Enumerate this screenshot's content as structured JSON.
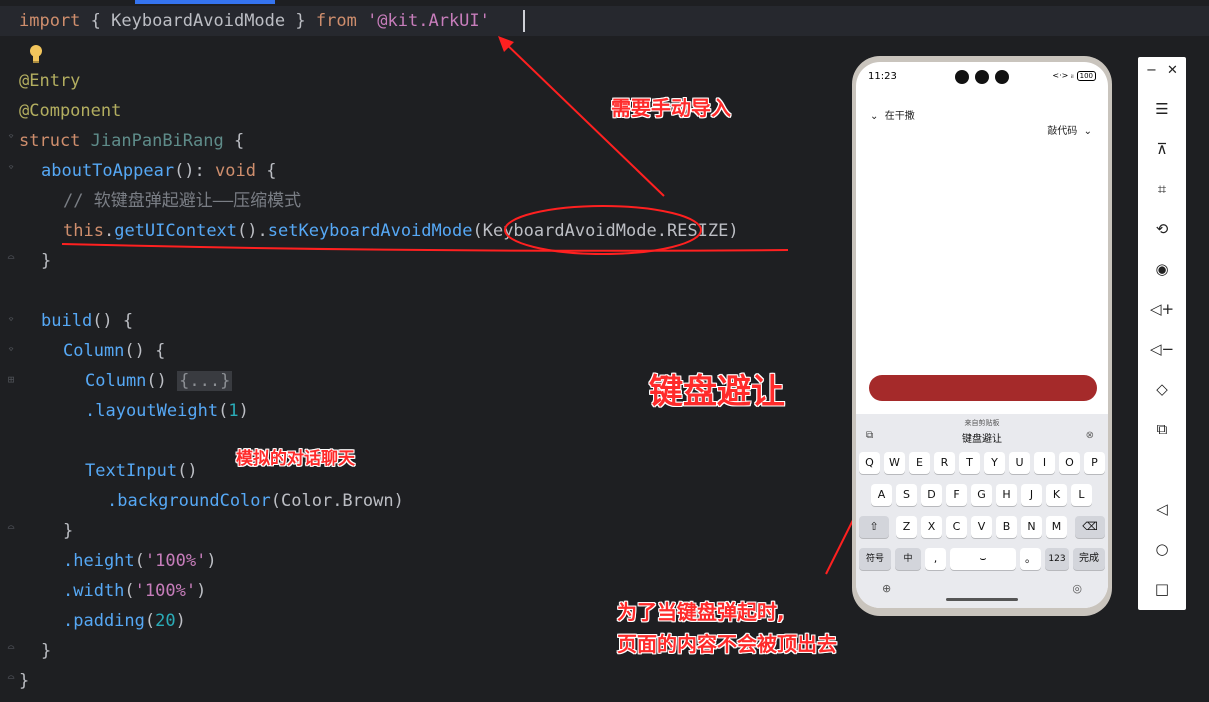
{
  "code": {
    "import_kw": "import",
    "import_open": " { ",
    "import_name": "KeyboardAvoidMode",
    "import_close": " } ",
    "import_from": "from",
    "import_path": "'@kit.ArkUI'",
    "entry": "@Entry",
    "component": "@Component",
    "struct_kw": "struct",
    "struct_name": "JianPanBiRang",
    "brace_open": " {",
    "about_fn": "aboutToAppear",
    "about_sig": "(): ",
    "void_kw": "void",
    "comment": "// 软键盘弹起避让——压缩模式",
    "this_kw": "this",
    "dot": ".",
    "get_ui": "getUIContext",
    "parens": "()",
    "set_mode": "setKeyboardAvoidMode",
    "open_paren": "(",
    "mode_arg": "KeyboardAvoidMode.RESIZE",
    "close_paren": ")",
    "close_brace": "}",
    "build_fn": "build",
    "column_fn": "Column",
    "fold_placeholder": "{...}",
    "layout_weight": ".layoutWeight",
    "layout_weight_val": "1",
    "text_input": "TextInput",
    "bg_color": ".backgroundColor",
    "color_arg": "Color.Brown",
    "height_fn": ".height",
    "height_val": "'100%'",
    "width_fn": ".width",
    "width_val": "'100%'",
    "padding_fn": ".padding",
    "padding_val": "20"
  },
  "annotations": {
    "manual_import": "需要手动导入",
    "keyboard_avoid": "键盘避让",
    "simulated_chat": "模拟的对话聊天",
    "explain_line1": "为了当键盘弹起时,",
    "explain_line2": "页面的内容不会被顶出去",
    "accent_color": "#ff2b2b"
  },
  "phone": {
    "time": "11:23",
    "status_right": "<·> ᵢₗ",
    "battery": "100",
    "app_top": "在干撒",
    "lang_selector": "敲代码",
    "input_color": "#a52a2a",
    "keyboard": {
      "clipboard_label": "来自剪贴板",
      "clipboard_text": "键盘避让",
      "row1": [
        "Q",
        "W",
        "E",
        "R",
        "T",
        "Y",
        "U",
        "I",
        "O",
        "P"
      ],
      "row2": [
        "A",
        "S",
        "D",
        "F",
        "G",
        "H",
        "J",
        "K",
        "L"
      ],
      "row3": [
        "Z",
        "X",
        "C",
        "V",
        "B",
        "N",
        "M"
      ],
      "symbols": "符号",
      "chinese": "中",
      "comma": ",",
      "period": "。",
      "numbers": "123",
      "done": "完成"
    }
  },
  "sidebar": {
    "minimize": "−",
    "close": "✕"
  }
}
